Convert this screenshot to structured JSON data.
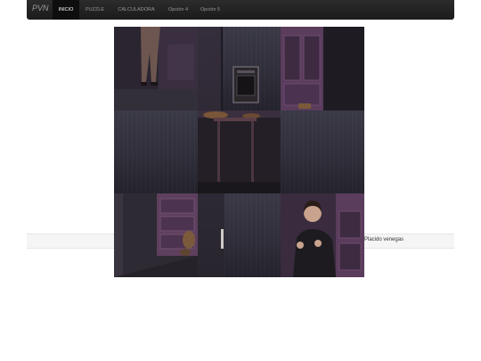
{
  "navbar": {
    "brand": "PVN",
    "items": [
      {
        "label": "INICIO",
        "active": true
      },
      {
        "label": "PUZZLE",
        "active": false
      },
      {
        "label": "CALCULADORA",
        "active": false
      },
      {
        "label": "Opción 4",
        "active": false
      },
      {
        "label": "Opción 5",
        "active": false
      }
    ]
  },
  "footer": {
    "text": "Placido venegas"
  },
  "colors": {
    "navbar_bg": "#1b1b1b",
    "active_item_bg": "#0e0e0e",
    "footer_bg": "#f5f5f5"
  }
}
